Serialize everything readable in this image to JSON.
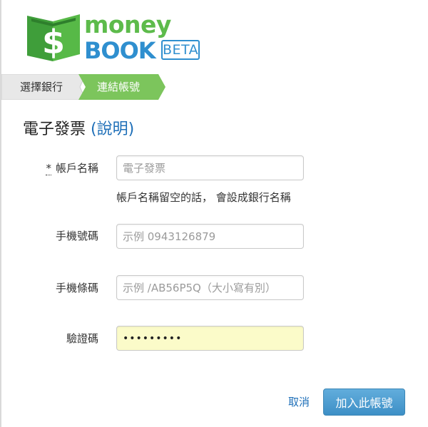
{
  "logo": {
    "word_top": "money",
    "word_bottom": "BOOK",
    "badge": "BETA",
    "mark_icon": "dollar-book-icon",
    "colors": {
      "green": "#5dbb4b",
      "blue": "#2f8fcf"
    }
  },
  "steps": [
    {
      "label": "選擇銀行",
      "active": false
    },
    {
      "label": "連結帳號",
      "active": true
    }
  ],
  "page": {
    "title": "電子發票",
    "help_link": "(說明)"
  },
  "form": {
    "account_name": {
      "required_mark": "*",
      "label": "帳戶名稱",
      "placeholder": "電子發票",
      "value": "",
      "hint": "帳戶名稱留空的話， 會設成銀行名稱"
    },
    "phone_number": {
      "label": "手機號碼",
      "placeholder": "示例 0943126879",
      "value": ""
    },
    "phone_barcode": {
      "label": "手機條碼",
      "placeholder": "示例 /AB56P5Q（大小寫有別）",
      "value": ""
    },
    "verification_code": {
      "label": "驗證碼",
      "value": "•••••••••"
    }
  },
  "actions": {
    "cancel_label": "取消",
    "submit_label": "加入此帳號"
  },
  "colors": {
    "accent_green": "#7cc55c",
    "link_blue": "#1e6fb8",
    "button_blue": "#4a9bd0",
    "autofill_yellow": "#fbfbc9"
  }
}
